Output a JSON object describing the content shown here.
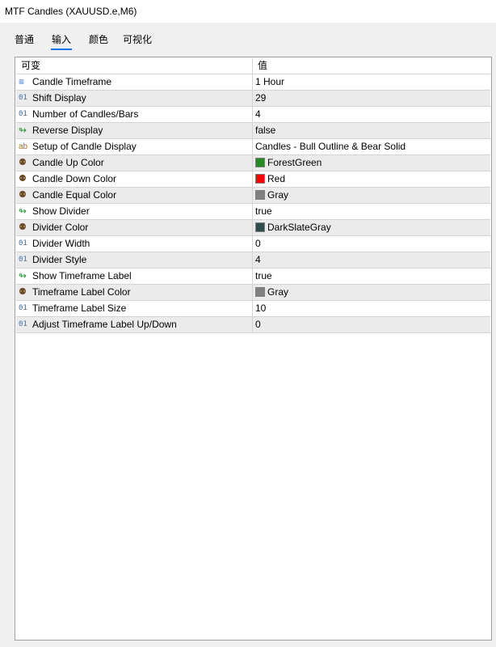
{
  "window": {
    "title": "MTF Candles (XAUUSD.e,M6)"
  },
  "tabs": [
    {
      "label": "普通"
    },
    {
      "label": "输入"
    },
    {
      "label": "颜色"
    },
    {
      "label": "可视化"
    }
  ],
  "active_tab": "输入",
  "grid": {
    "header": {
      "name": "可变",
      "value": "值"
    },
    "rows": [
      {
        "name": "Candle Timeframe",
        "value": "1 Hour",
        "icon": "enum-icon"
      },
      {
        "name": "Shift Display",
        "value": "29",
        "icon": "number-icon",
        "icon_text": "01"
      },
      {
        "name": "Number of Candles/Bars",
        "value": "4",
        "icon": "number-icon",
        "icon_text": "01"
      },
      {
        "name": "Reverse Display",
        "value": "false",
        "icon": "boolean-icon"
      },
      {
        "name": "Setup of Candle Display",
        "value": "Candles - Bull Outline & Bear Solid",
        "icon": "string-icon",
        "icon_text": "ab"
      },
      {
        "name": "Candle Up Color",
        "value": "ForestGreen",
        "icon": "color-icon",
        "swatch": "#228b22"
      },
      {
        "name": "Candle Down Color",
        "value": "Red",
        "icon": "color-icon",
        "swatch": "#ff0000"
      },
      {
        "name": "Candle Equal Color",
        "value": "Gray",
        "icon": "color-icon",
        "swatch": "#808080"
      },
      {
        "name": "Show Divider",
        "value": "true",
        "icon": "boolean-icon"
      },
      {
        "name": "Divider Color",
        "value": "DarkSlateGray",
        "icon": "color-icon",
        "swatch": "#2f4f4f"
      },
      {
        "name": "Divider Width",
        "value": "0",
        "icon": "number-icon",
        "icon_text": "01"
      },
      {
        "name": "Divider Style",
        "value": "4",
        "icon": "number-icon",
        "icon_text": "01"
      },
      {
        "name": "Show Timeframe Label",
        "value": "true",
        "icon": "boolean-icon"
      },
      {
        "name": "Timeframe Label Color",
        "value": "Gray",
        "icon": "color-icon",
        "swatch": "#808080"
      },
      {
        "name": "Timeframe Label Size",
        "value": "10",
        "icon": "number-icon",
        "icon_text": "01"
      },
      {
        "name": "Adjust Timeframe Label Up/Down",
        "value": "0",
        "icon": "number-icon",
        "icon_text": "01"
      }
    ]
  },
  "colors": {
    "accent": "#1a73e8",
    "row_alt": "#ebebeb"
  }
}
